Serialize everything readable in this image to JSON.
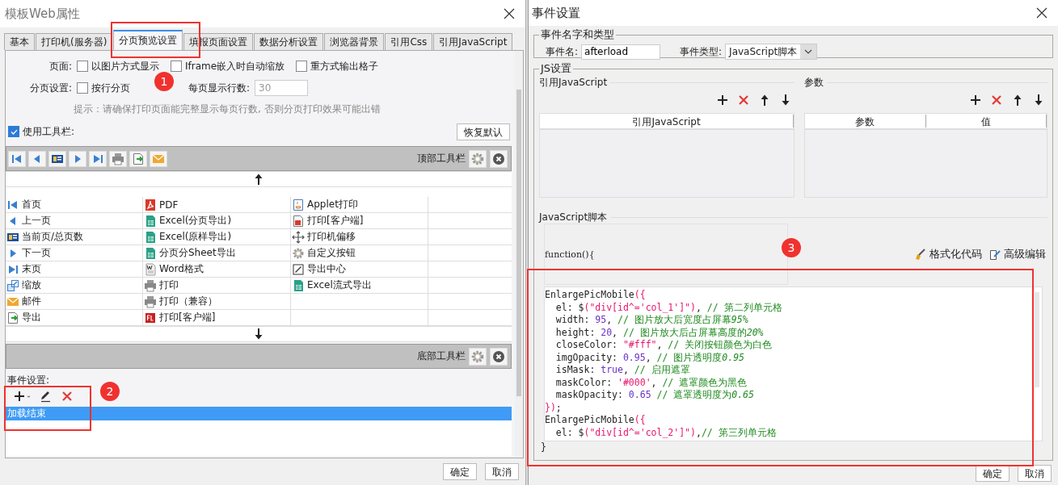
{
  "left": {
    "title": "模板Web属性",
    "tabs": [
      {
        "label": "基本",
        "selected": false
      },
      {
        "label": "打印机(服务器)",
        "selected": false
      },
      {
        "label": "分页预览设置",
        "selected": true
      },
      {
        "label": "填报页面设置",
        "selected": false
      },
      {
        "label": "数据分析设置",
        "selected": false
      },
      {
        "label": "浏览器背景",
        "selected": false
      },
      {
        "label": "引用Css",
        "selected": false
      },
      {
        "label": "引用JavaScript",
        "selected": false
      }
    ],
    "page_row": {
      "label": "页面:",
      "options": [
        {
          "label": "以图片方式显示",
          "checked": false
        },
        {
          "label": "Iframe嵌入时自动缩放",
          "checked": false
        },
        {
          "label": "重方式输出格子",
          "checked": false
        }
      ]
    },
    "paging_row": {
      "label": "分页设置:",
      "option": {
        "label": "按行分页",
        "checked": false
      },
      "rows_label": "每页显示行数:",
      "rows_field": {
        "value": "30",
        "disabled": true
      }
    },
    "hint": "提示：请确保打印页面能完整显示每页行数, 否则分页打印效果可能出错",
    "use_toolbar": {
      "label": "使用工具栏:",
      "checked": true
    },
    "restore_button": "恢复默认",
    "top_toolbar": {
      "label": "顶部工具栏",
      "buttons": [
        {
          "kind": "first"
        },
        {
          "kind": "prev"
        },
        {
          "kind": "page"
        },
        {
          "kind": "next"
        },
        {
          "kind": "last"
        },
        {
          "kind": "print"
        },
        {
          "kind": "export"
        },
        {
          "kind": "mail"
        }
      ]
    },
    "button_columns": [
      [
        {
          "label": "首页",
          "kind": "first"
        },
        {
          "label": "上一页",
          "kind": "prev"
        },
        {
          "label": "当前页/总页数",
          "kind": "page"
        },
        {
          "label": "下一页",
          "kind": "next"
        },
        {
          "label": "末页",
          "kind": "last"
        },
        {
          "label": "缩放",
          "kind": "zoom"
        },
        {
          "label": "邮件",
          "kind": "mail"
        },
        {
          "label": "导出",
          "kind": "export"
        }
      ],
      [
        {
          "label": "PDF",
          "kind": "pdf"
        },
        {
          "label": "Excel(分页导出)",
          "kind": "excel"
        },
        {
          "label": "Excel(原样导出)",
          "kind": "excel"
        },
        {
          "label": "分页分Sheet导出",
          "kind": "excel"
        },
        {
          "label": "Word格式",
          "kind": "word"
        },
        {
          "label": "打印",
          "kind": "print"
        },
        {
          "label": "打印（兼容）",
          "kind": "print"
        },
        {
          "label": "打印[客户端]",
          "kind": "flash"
        }
      ],
      [
        {
          "label": "Applet打印",
          "kind": "applet"
        },
        {
          "label": "打印[客户端]",
          "kind": "pdfprint"
        },
        {
          "label": "打印机偏移",
          "kind": "move"
        },
        {
          "label": "自定义按钮",
          "kind": "gear"
        },
        {
          "label": "导出中心",
          "kind": "exportcenter"
        },
        {
          "label": "Excel流式导出",
          "kind": "excel"
        }
      ]
    ],
    "bottom_toolbar": {
      "label": "底部工具栏"
    },
    "events_label": "事件设置:",
    "events": [
      {
        "label": "加载结束",
        "selected": true
      }
    ],
    "buttons": [
      "确定",
      "取消"
    ]
  },
  "right": {
    "title": "事件设置",
    "name_group": {
      "title": "事件名字和类型",
      "name_label": "事件名:",
      "name_value": "afterload",
      "type_label": "事件类型:",
      "type_value": "JavaScript脚本"
    },
    "js_group": {
      "title": "JS设置",
      "ref_section": {
        "title": "引用JavaScript",
        "columns": [
          "引用JavaScript"
        ]
      },
      "param_section": {
        "title": "参数",
        "columns": [
          "参数",
          "值"
        ]
      },
      "script_section": {
        "title": "JavaScript脚本",
        "header": "function(){",
        "format_button": "格式化代码",
        "advanced_button": "高级编辑",
        "code": [
          [
            {
              "text": "EnlargePicMobile",
              "kind": "plain"
            },
            {
              "text": "({",
              "kind": "bracket"
            }
          ],
          [
            {
              "text": "  el: $",
              "kind": "plain"
            },
            {
              "text": "(",
              "kind": "bracket"
            },
            {
              "text": "\"div[id^='col_1']\"",
              "kind": "string"
            },
            {
              "text": ")",
              "kind": "bracket"
            },
            {
              "text": ", ",
              "kind": "plain"
            },
            {
              "text": "// 第二列单元格",
              "kind": "comment"
            }
          ],
          [
            {
              "text": "  width: ",
              "kind": "plain"
            },
            {
              "text": "95",
              "kind": "number"
            },
            {
              "text": ", ",
              "kind": "plain"
            },
            {
              "text": "// 图片放大后宽度占屏幕",
              "kind": "comment"
            },
            {
              "text": "95%",
              "kind": "comment_italic"
            }
          ],
          [
            {
              "text": "  height: ",
              "kind": "plain"
            },
            {
              "text": "20",
              "kind": "number"
            },
            {
              "text": ", ",
              "kind": "plain"
            },
            {
              "text": "// 图片放大后占屏幕高度的",
              "kind": "comment"
            },
            {
              "text": "20%",
              "kind": "comment_italic"
            }
          ],
          [
            {
              "text": "  closeColor: ",
              "kind": "plain"
            },
            {
              "text": "\"#fff\"",
              "kind": "string"
            },
            {
              "text": ", ",
              "kind": "plain"
            },
            {
              "text": "// 关闭按钮颜色为白色",
              "kind": "comment"
            }
          ],
          [
            {
              "text": "  imgOpacity: ",
              "kind": "plain"
            },
            {
              "text": "0.95",
              "kind": "number"
            },
            {
              "text": ", ",
              "kind": "plain"
            },
            {
              "text": "// 图片透明度",
              "kind": "comment"
            },
            {
              "text": "0.95",
              "kind": "comment_italic"
            }
          ],
          [
            {
              "text": "  isMask: ",
              "kind": "plain"
            },
            {
              "text": "true",
              "kind": "number"
            },
            {
              "text": ", ",
              "kind": "plain"
            },
            {
              "text": "// 启用遮罩",
              "kind": "comment"
            }
          ],
          [
            {
              "text": "  maskColor: ",
              "kind": "plain"
            },
            {
              "text": "'#000'",
              "kind": "string"
            },
            {
              "text": ", ",
              "kind": "plain"
            },
            {
              "text": "// 遮罩颜色为黑色",
              "kind": "comment"
            }
          ],
          [
            {
              "text": "  maskOpacity: ",
              "kind": "plain"
            },
            {
              "text": "0.65",
              "kind": "number"
            },
            {
              "text": "// 遮罩透明度为",
              "kind": "comment_spaced"
            },
            {
              "text": "0.65",
              "kind": "comment_italic"
            }
          ],
          [
            {
              "text": "})",
              "kind": "bracket"
            },
            {
              "text": ";",
              "kind": "plain"
            }
          ],
          [
            {
              "text": "EnlargePicMobile",
              "kind": "plain"
            },
            {
              "text": "({",
              "kind": "bracket"
            }
          ],
          [
            {
              "text": "  el: $",
              "kind": "plain"
            },
            {
              "text": "(",
              "kind": "bracket"
            },
            {
              "text": "\"div[id^='col_2']\"",
              "kind": "string"
            },
            {
              "text": ")",
              "kind": "bracket"
            },
            {
              "text": ",",
              "kind": "plain"
            },
            {
              "text": "// 第三列单元格",
              "kind": "comment"
            }
          ]
        ],
        "footer": "}"
      }
    },
    "buttons": [
      "确定",
      "取消"
    ]
  },
  "callouts": [
    {
      "number": "1"
    },
    {
      "number": "2"
    },
    {
      "number": "3"
    }
  ]
}
